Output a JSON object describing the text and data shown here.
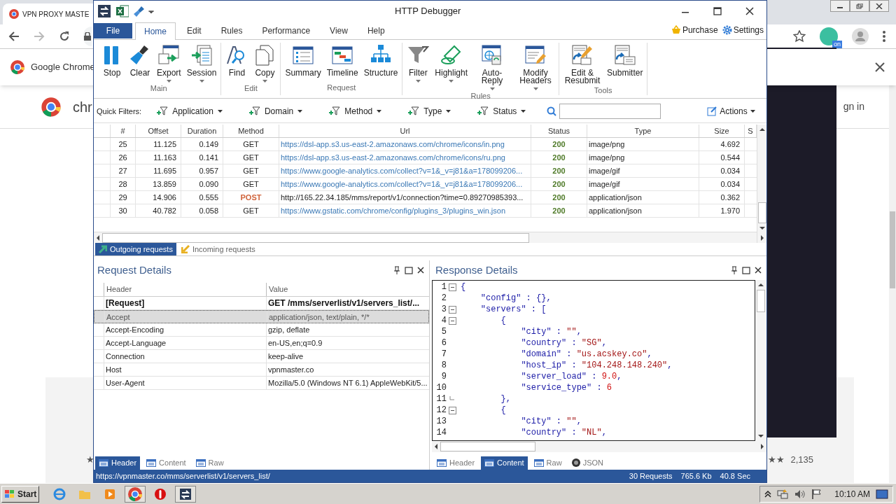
{
  "browser": {
    "tab_title": "VPN PROXY MASTE",
    "infobar_text": "Google Chrome",
    "page_heading": "chr",
    "sign_in": "gn in",
    "extension_badge": "on",
    "left_star": "★",
    "rating_stars": "★★",
    "rating_count": "2,135"
  },
  "window": {
    "title": "HTTP Debugger"
  },
  "ribbon": {
    "file": "File",
    "tabs": [
      {
        "label": "Home",
        "selected": true
      },
      {
        "label": "Edit",
        "selected": false
      },
      {
        "label": "Rules",
        "selected": false
      },
      {
        "label": "Performance",
        "selected": false
      },
      {
        "label": "View",
        "selected": false
      },
      {
        "label": "Help",
        "selected": false
      }
    ],
    "purchase": "Purchase",
    "settings": "Settings",
    "groups": [
      {
        "label": "Main",
        "buttons": [
          {
            "label": "Stop",
            "dropdown": false
          },
          {
            "label": "Clear",
            "dropdown": false
          },
          {
            "label": "Export",
            "dropdown": true
          },
          {
            "label": "Session",
            "dropdown": true
          }
        ]
      },
      {
        "label": "Edit",
        "buttons": [
          {
            "label": "Find",
            "dropdown": false
          },
          {
            "label": "Copy",
            "dropdown": true
          }
        ]
      },
      {
        "label": "Request",
        "buttons": [
          {
            "label": "Summary",
            "dropdown": false
          },
          {
            "label": "Timeline",
            "dropdown": false
          },
          {
            "label": "Structure",
            "dropdown": false
          }
        ]
      },
      {
        "label": "Rules",
        "buttons": [
          {
            "label": "Filter",
            "dropdown": true
          },
          {
            "label": "Highlight",
            "dropdown": true
          },
          {
            "label": "Auto-Reply",
            "dropdown": true
          },
          {
            "label": "Modify Headers",
            "dropdown": true
          }
        ]
      },
      {
        "label": "Tools",
        "buttons": [
          {
            "label": "Edit & Resubmit",
            "dropdown": false
          },
          {
            "label": "Submitter",
            "dropdown": false
          }
        ]
      }
    ]
  },
  "quick_filters": {
    "label": "Quick Filters:",
    "filters": [
      "Application",
      "Domain",
      "Method",
      "Type",
      "Status"
    ],
    "actions": "Actions"
  },
  "requests_table": {
    "columns": [
      "#",
      "Offset",
      "Duration",
      "Method",
      "Url",
      "Status",
      "Type",
      "Size",
      "S"
    ],
    "rows": [
      {
        "kind": "get",
        "cells": [
          "25",
          "11.125",
          "0.149",
          "GET",
          "https://dsl-app.s3.us-east-2.amazonaws.com/chrome/icons/in.png",
          "200",
          "image/png",
          "4.692"
        ]
      },
      {
        "kind": "get",
        "cells": [
          "26",
          "11.163",
          "0.141",
          "GET",
          "https://dsl-app.s3.us-east-2.amazonaws.com/chrome/icons/ru.png",
          "200",
          "image/png",
          "0.544"
        ]
      },
      {
        "kind": "get",
        "cells": [
          "27",
          "11.695",
          "0.957",
          "GET",
          "https://www.google-analytics.com/collect?v=1&_v=j81&a=178099206...",
          "200",
          "image/gif",
          "0.034"
        ]
      },
      {
        "kind": "get",
        "cells": [
          "28",
          "13.859",
          "0.090",
          "GET",
          "https://www.google-analytics.com/collect?v=1&_v=j81&a=178099206...",
          "200",
          "image/gif",
          "0.034"
        ]
      },
      {
        "kind": "post",
        "cells": [
          "29",
          "14.906",
          "0.555",
          "POST",
          "http://165.22.34.185/mms/report/v1/connection?time=0.89270985393...",
          "200",
          "application/json",
          "0.362"
        ]
      },
      {
        "kind": "get",
        "cells": [
          "30",
          "40.782",
          "0.058",
          "GET",
          "https://www.gstatic.com/chrome/config/plugins_3/plugins_win.json",
          "200",
          "application/json",
          "1.970"
        ]
      }
    ]
  },
  "list_tabs": [
    {
      "label": "Outgoing requests",
      "selected": true
    },
    {
      "label": "Incoming requests",
      "selected": false
    }
  ],
  "request_details": {
    "title": "Request Details",
    "columns": [
      "Header",
      "Value"
    ],
    "rows": [
      {
        "kind": "request",
        "header": "[Request]",
        "value": "GET /mms/serverlist/v1/servers_list/...",
        "selected": false
      },
      {
        "kind": "header",
        "header": "Accept",
        "value": "application/json, text/plain, */*",
        "selected": true
      },
      {
        "kind": "header",
        "header": "Accept-Encoding",
        "value": "gzip, deflate",
        "selected": false
      },
      {
        "kind": "header",
        "header": "Accept-Language",
        "value": "en-US,en;q=0.9",
        "selected": false
      },
      {
        "kind": "header",
        "header": "Connection",
        "value": "keep-alive",
        "selected": false
      },
      {
        "kind": "header",
        "header": "Host",
        "value": "vpnmaster.co",
        "selected": false
      },
      {
        "kind": "header",
        "header": "User-Agent",
        "value": "Mozilla/5.0 (Windows NT 6.1) AppleWebKit/5...",
        "selected": false
      }
    ],
    "tabs": [
      {
        "label": "Header",
        "selected": true
      },
      {
        "label": "Content",
        "selected": false
      },
      {
        "label": "Raw",
        "selected": false
      }
    ]
  },
  "response_details": {
    "title": "Response Details",
    "lines": [
      {
        "number": "1",
        "kind": "fold_start",
        "text": "{"
      },
      {
        "number": "2",
        "kind": "code",
        "text": "    \"config\" : {},"
      },
      {
        "number": "3",
        "kind": "fold_start",
        "text": "    \"servers\" : ["
      },
      {
        "number": "4",
        "kind": "fold_start",
        "text": "        {"
      },
      {
        "number": "5",
        "kind": "code",
        "text": "            \"city\" : \"\","
      },
      {
        "number": "6",
        "kind": "code",
        "text": "            \"country\" : \"SG\","
      },
      {
        "number": "7",
        "kind": "code",
        "text": "            \"domain\" : \"us.acskey.co\","
      },
      {
        "number": "8",
        "kind": "code",
        "text": "            \"host_ip\" : \"104.248.148.240\","
      },
      {
        "number": "9",
        "kind": "code",
        "text": "            \"server_load\" : 9.0,"
      },
      {
        "number": "10",
        "kind": "code",
        "text": "            \"service_type\" : 6"
      },
      {
        "number": "11",
        "kind": "fold_end",
        "text": "        },"
      },
      {
        "number": "12",
        "kind": "fold_start",
        "text": "        {"
      },
      {
        "number": "13",
        "kind": "code",
        "text": "            \"city\" : \"\","
      },
      {
        "number": "14",
        "kind": "code",
        "text": "            \"country\" : \"NL\","
      }
    ],
    "tabs": [
      {
        "label": "Header",
        "selected": false
      },
      {
        "label": "Content",
        "selected": true
      },
      {
        "label": "Raw",
        "selected": false
      },
      {
        "label": "JSON",
        "selected": false
      }
    ]
  },
  "status_bar": {
    "url": "https://vpnmaster.co/mms/serverlist/v1/servers_list/",
    "requests": "30 Requests",
    "size": "765.6 Kb",
    "time": "40.8 Sec"
  },
  "taskbar": {
    "start": "Start",
    "clock": "10:10 AM"
  }
}
